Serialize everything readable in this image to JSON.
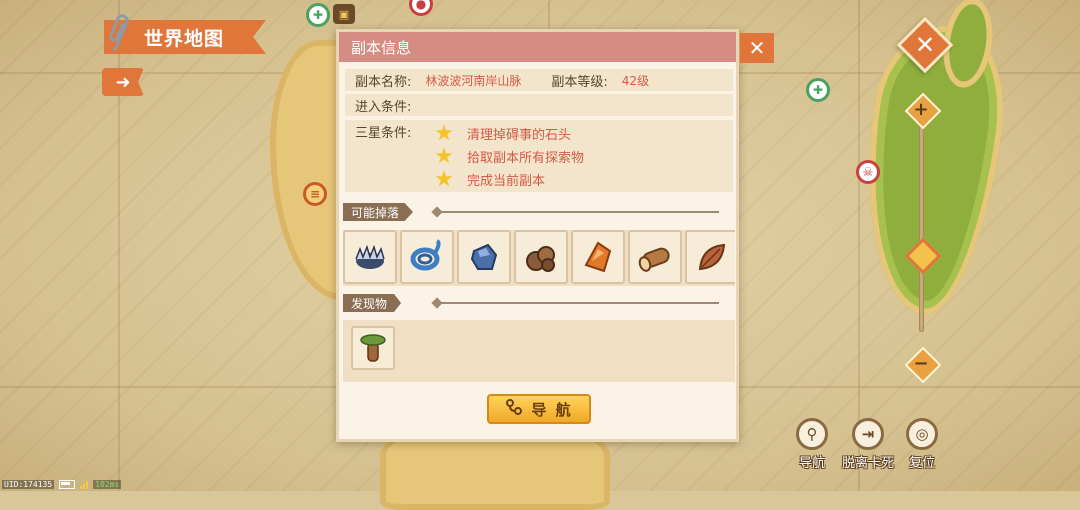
{
  "header": {
    "title": "世界地图",
    "back_icon": "arrow-right-icon",
    "clip_icon": "paperclip-icon"
  },
  "dialog": {
    "title": "副本信息",
    "name_label": "副本名称:",
    "name_value": "林波波河南岸山脉",
    "level_label": "副本等级:",
    "level_value": "42级",
    "entry_label": "进入条件:",
    "entry_value": "",
    "three_star_label": "三星条件:",
    "three_star_conditions": [
      "清理掉碍事的石头",
      "拾取副本所有探索物",
      "完成当前副本"
    ],
    "drops_label": "可能掉落",
    "drops": [
      {
        "icon": "spiked-trap-icon"
      },
      {
        "icon": "rope-coil-icon"
      },
      {
        "icon": "blue-stone-icon"
      },
      {
        "icon": "ore-lumps-icon"
      },
      {
        "icon": "amber-crystal-icon"
      },
      {
        "icon": "wood-log-icon"
      },
      {
        "icon": "dried-leaf-icon"
      }
    ],
    "finds_label": "发现物",
    "finds": [
      {
        "icon": "baobab-tree-icon"
      }
    ],
    "navigate_label": "导 航"
  },
  "actions": {
    "navigate": "导航",
    "escape": "脱离卡死",
    "reset": "复位"
  },
  "status": {
    "uid": "UID:174135",
    "ping": "102ms"
  },
  "colors": {
    "accent": "#e0763a",
    "header": "#d58c83",
    "condition_text": "#d25b45",
    "button": "#f0a928"
  }
}
